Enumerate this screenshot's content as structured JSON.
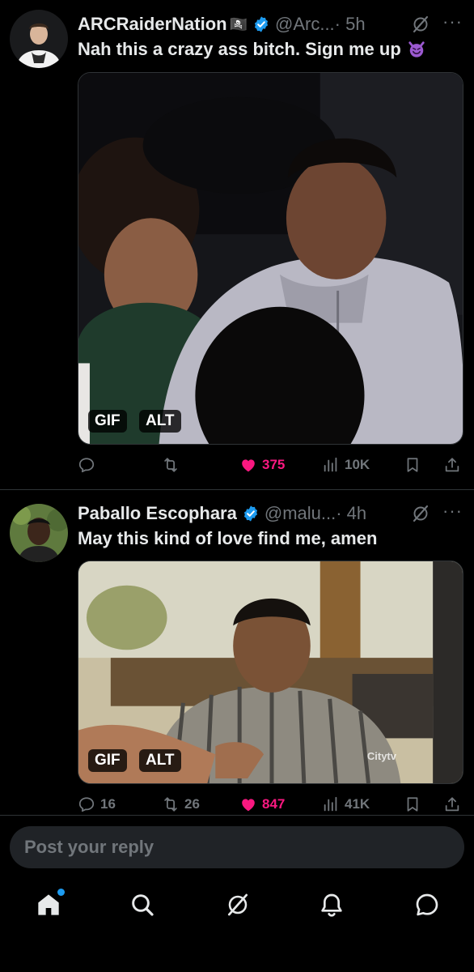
{
  "colors": {
    "background": "#000000",
    "text": "#e7e9ea",
    "secondary": "#71767b",
    "like": "#f91880",
    "verified": "#1d9bf0"
  },
  "tweets": [
    {
      "author": "ARCRaiderNation",
      "author_flag_icon": "pirate-flag-icon",
      "handle": "@Arc...",
      "time": "· 5h",
      "text": "Nah this a crazy ass bitch. Sign me up",
      "emoji_icon": "smiling-devil-icon",
      "media": {
        "gif_label": "GIF",
        "alt_label": "ALT",
        "watermark": ""
      },
      "stats": {
        "replies": "",
        "retweets": "",
        "likes": "375",
        "views": "10K"
      },
      "liked": true
    },
    {
      "author": "Paballo Escophara",
      "handle": "@malu...",
      "time": "· 4h",
      "text": "May this kind of love find me, amen",
      "media": {
        "gif_label": "GIF",
        "alt_label": "ALT",
        "watermark": "Citytv"
      },
      "stats": {
        "replies": "16",
        "retweets": "26",
        "likes": "847",
        "views": "41K"
      },
      "liked": true
    }
  ],
  "composer": {
    "placeholder": "Post your reply"
  },
  "bottom_nav": [
    "home-icon",
    "search-icon",
    "grok-icon",
    "notifications-bell-icon",
    "messages-icon"
  ]
}
